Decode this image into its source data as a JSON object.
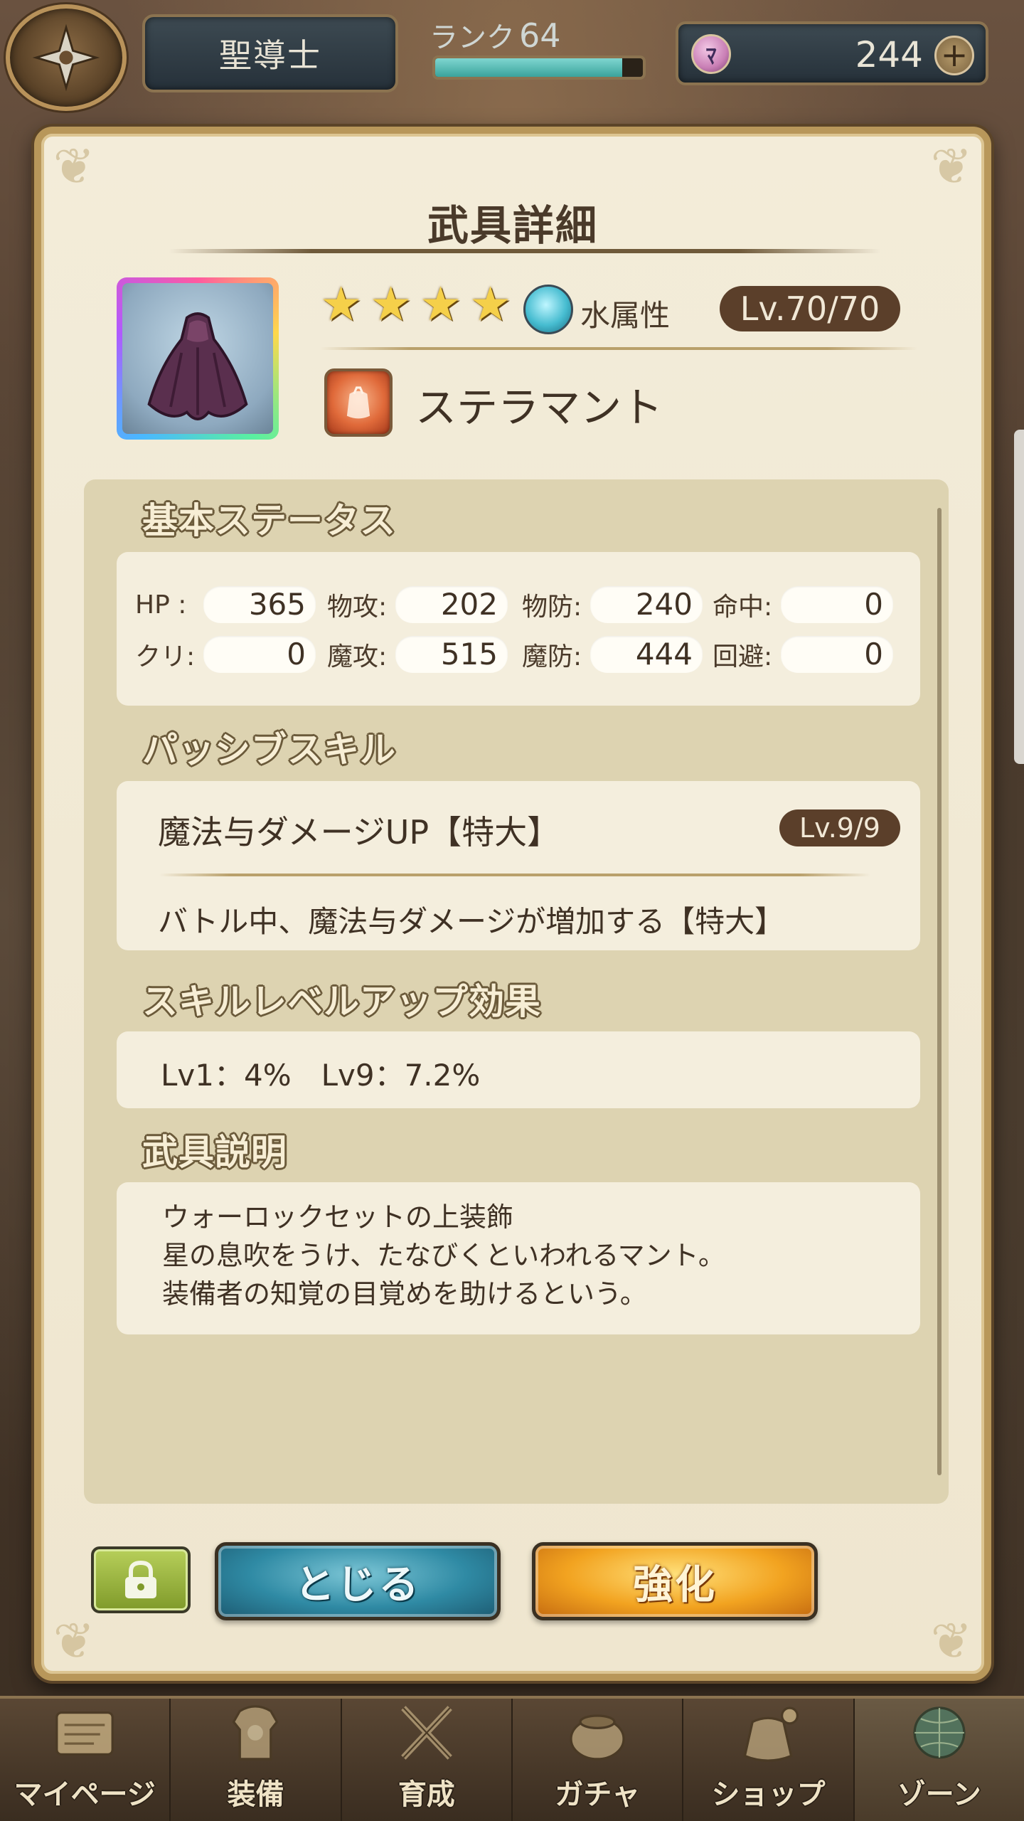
{
  "header": {
    "job": "聖導士",
    "rank_label": "ランク",
    "rank_value": "64",
    "rank_progress": 0.9,
    "gem_count": "244",
    "gem_symbol": "ﾏ",
    "plus_symbol": "+"
  },
  "panel": {
    "title": "武具詳細",
    "item": {
      "stars": [
        "★",
        "★",
        "★",
        "★"
      ],
      "attribute": "水属性",
      "level": "Lv.70/70",
      "name": "ステラマント"
    },
    "basic_status": {
      "title": "基本ステータス",
      "stats": [
        {
          "label": "HP :",
          "value": "365"
        },
        {
          "label": "物攻:",
          "value": "202"
        },
        {
          "label": "物防:",
          "value": "240"
        },
        {
          "label": "命中:",
          "value": "0"
        },
        {
          "label": "クリ:",
          "value": "0"
        },
        {
          "label": "魔攻:",
          "value": "515"
        },
        {
          "label": "魔防:",
          "value": "444"
        },
        {
          "label": "回避:",
          "value": "0"
        }
      ]
    },
    "passive_skill": {
      "title": "パッシブスキル",
      "name": "魔法与ダメージUP【特大】",
      "level": "Lv.9/9",
      "description": "バトル中、魔法与ダメージが増加する【特大】"
    },
    "skill_levelup": {
      "title": "スキルレベルアップ効果",
      "text": "Lv1：4%　Lv9：7.2%"
    },
    "item_description": {
      "title": "武具説明",
      "lines": [
        "ウォーロックセットの上装飾",
        "星の息吹をうけ、たなびくといわれるマント。",
        "装備者の知覚の目覚めを助けるという。"
      ]
    },
    "buttons": {
      "close": "とじる",
      "enhance": "強化"
    }
  },
  "bottom_nav": [
    {
      "label": "マイページ",
      "icon": "map-scroll-icon"
    },
    {
      "label": "装備",
      "icon": "armor-icon"
    },
    {
      "label": "育成",
      "icon": "crossed-swords-icon"
    },
    {
      "label": "ガチャ",
      "icon": "treasure-pot-icon"
    },
    {
      "label": "ショップ",
      "icon": "coin-bag-icon"
    },
    {
      "label": "ゾーン",
      "icon": "globe-icon"
    }
  ],
  "colors": {
    "panel_bg": "#f3ecd9",
    "frame_gold": "#b8975a",
    "pill_brown": "#5b3f2a",
    "close_teal": "#2f8aa4",
    "enhance_orange": "#f2a320"
  }
}
